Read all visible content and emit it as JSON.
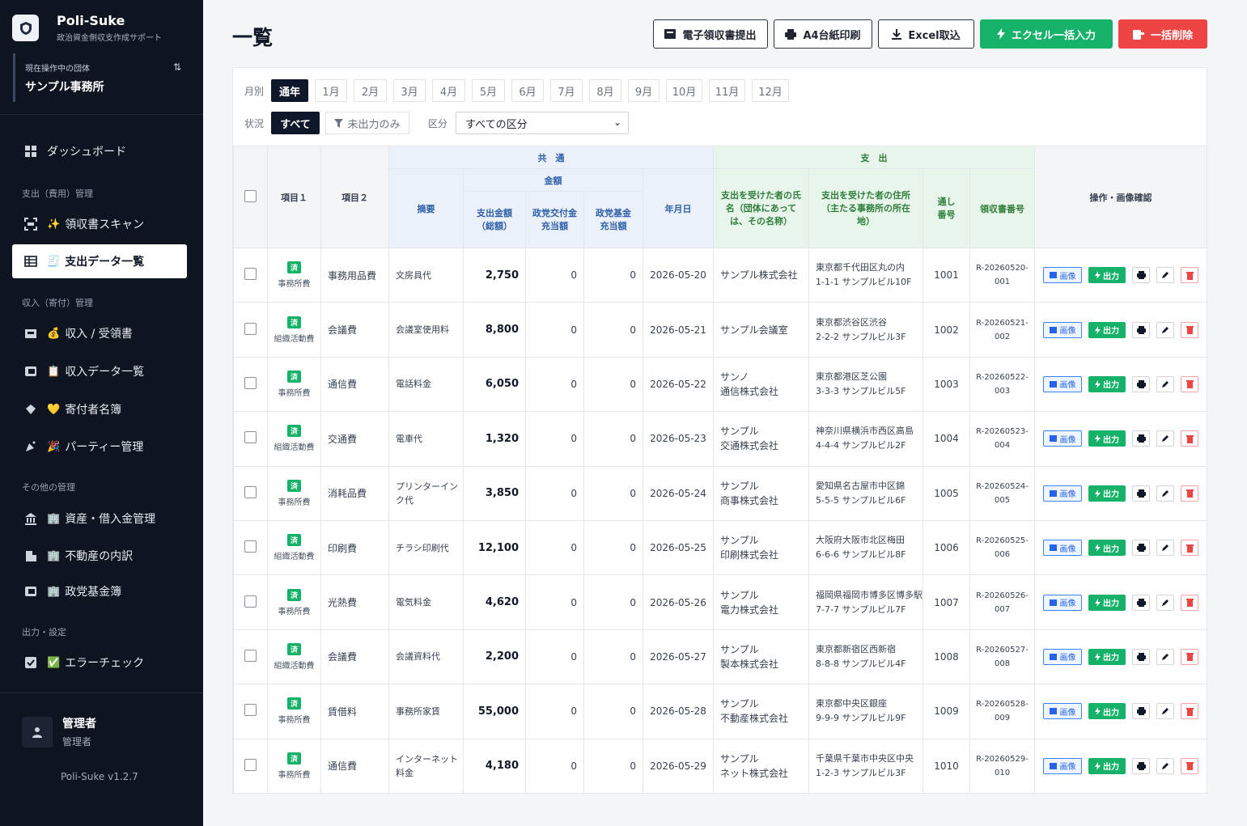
{
  "brand": {
    "name": "Poli-Suke",
    "subtitle": "政治資金側収支作成サポート"
  },
  "org": {
    "label": "現在操作中の団体",
    "name": "サンプル事務所"
  },
  "sidebar": {
    "dashboard": "ダッシュボード",
    "section_expense": "支出（費用）管理",
    "receipt_scan": "領収書スキャン",
    "expense_list": "支出データ一覧",
    "section_income": "収入（寄付）管理",
    "income_receipt": "収入 / 受領書",
    "income_list": "収入データ一覧",
    "donor_list": "寄付者名簿",
    "party_mgmt": "パーティー管理",
    "section_other": "その他の管理",
    "assets": "資産・借入金管理",
    "real_estate": "不動産の内訳",
    "fund_book": "政党基金簿",
    "section_output": "出力・設定",
    "error_check": "エラーチェック"
  },
  "user": {
    "name": "管理者",
    "role": "管理者"
  },
  "version": "Poli-Suke v1.2.7",
  "page": {
    "title": "一覧"
  },
  "toolbar": {
    "e_receipt": "電子領収書提出",
    "print_a4": "A4台紙印刷",
    "excel_import": "Excel取込",
    "excel_bulk": "エクセル一括入力",
    "bulk_delete": "一括削除"
  },
  "filters": {
    "month_label": "月別",
    "months": [
      "通年",
      "1月",
      "2月",
      "3月",
      "4月",
      "5月",
      "6月",
      "7月",
      "8月",
      "9月",
      "10月",
      "11月",
      "12月"
    ],
    "status_label": "状況",
    "status_all": "すべて",
    "status_unexported": "未出力のみ",
    "category_label": "区分",
    "category_value": "すべての区分"
  },
  "table": {
    "group_common": "共　通",
    "group_expense": "支　出",
    "group_amount": "金額",
    "col_item1": "項目１",
    "col_item2": "項目２",
    "col_summary": "摘要",
    "col_total": "支出金額（総額）",
    "col_party_grant": "政党交付金充当額",
    "col_party_fund": "政党基金充当額",
    "col_date": "年月日",
    "col_payee": "支出を受けた者の氏名（団体にあっては、その名称）",
    "col_address": "支出を受けた者の住所（主たる事務所の所在地）",
    "col_serial": "通し番号",
    "col_receipt_no": "領収書番号",
    "col_ops": "操作・画像確認",
    "op_image": "画像",
    "op_output": "出力",
    "rows": [
      {
        "status": "済",
        "item1": "事務所費",
        "item2": "事務用品費",
        "summary": "文房具代",
        "total": "2,750",
        "grant": "0",
        "fund": "0",
        "date": "2026-05-20",
        "payee": "サンプル株式会社",
        "address": "東京都千代田区丸の内\n1-1-1 サンプルビル10F",
        "serial": "1001",
        "receipt": "R-20260520-\n001"
      },
      {
        "status": "済",
        "item1": "組織活動費",
        "item2": "会議費",
        "summary": "会議室使用料",
        "total": "8,800",
        "grant": "0",
        "fund": "0",
        "date": "2026-05-21",
        "payee": "サンプル会議室",
        "address": "東京都渋谷区渋谷\n2-2-2 サンプルビル3F",
        "serial": "1002",
        "receipt": "R-20260521-\n002"
      },
      {
        "status": "済",
        "item1": "事務所費",
        "item2": "通信費",
        "summary": "電話料金",
        "total": "6,050",
        "grant": "0",
        "fund": "0",
        "date": "2026-05-22",
        "payee": "サンノ\n通信株式会社",
        "address": "東京都港区芝公園\n3-3-3 サンプルビル5F",
        "serial": "1003",
        "receipt": "R-20260522-\n003"
      },
      {
        "status": "済",
        "item1": "組織活動費",
        "item2": "交通費",
        "summary": "電車代",
        "total": "1,320",
        "grant": "0",
        "fund": "0",
        "date": "2026-05-23",
        "payee": "サンプル\n交通株式会社",
        "address": "神奈川県横浜市西区高島\n4-4-4 サンプルビル2F",
        "serial": "1004",
        "receipt": "R-20260523-\n004"
      },
      {
        "status": "済",
        "item1": "事務所費",
        "item2": "消耗品費",
        "summary": "プリンターイン\nク代",
        "total": "3,850",
        "grant": "0",
        "fund": "0",
        "date": "2026-05-24",
        "payee": "サンプル\n商事株式会社",
        "address": "愛知県名古屋市中区錦\n5-5-5 サンプルビル6F",
        "serial": "1005",
        "receipt": "R-20260524-\n005"
      },
      {
        "status": "済",
        "item1": "組織活動費",
        "item2": "印刷費",
        "summary": "チラシ印刷代",
        "total": "12,100",
        "grant": "0",
        "fund": "0",
        "date": "2026-05-25",
        "payee": "サンプル\n印刷株式会社",
        "address": "大阪府大阪市北区梅田\n6-6-6 サンプルビル8F",
        "serial": "1006",
        "receipt": "R-20260525-\n006"
      },
      {
        "status": "済",
        "item1": "事務所費",
        "item2": "光熱費",
        "summary": "電気料金",
        "total": "4,620",
        "grant": "0",
        "fund": "0",
        "date": "2026-05-26",
        "payee": "サンプル\n電力株式会社",
        "address": "福岡県福岡市博多区博多駅\n7-7-7 サンプルビル7F",
        "serial": "1007",
        "receipt": "R-20260526-\n007"
      },
      {
        "status": "済",
        "item1": "組織活動費",
        "item2": "会議費",
        "summary": "会議資料代",
        "total": "2,200",
        "grant": "0",
        "fund": "0",
        "date": "2026-05-27",
        "payee": "サンプル\n製本株式会社",
        "address": "東京都新宿区西新宿\n8-8-8 サンプルビル4F",
        "serial": "1008",
        "receipt": "R-20260527-\n008"
      },
      {
        "status": "済",
        "item1": "事務所費",
        "item2": "賃借料",
        "summary": "事務所家賃",
        "total": "55,000",
        "grant": "0",
        "fund": "0",
        "date": "2026-05-28",
        "payee": "サンプル\n不動産株式会社",
        "address": "東京都中央区銀座\n9-9-9 サンプルビル9F",
        "serial": "1009",
        "receipt": "R-20260528-\n009"
      },
      {
        "status": "済",
        "item1": "事務所費",
        "item2": "通信費",
        "summary": "インターネット\n料金",
        "total": "4,180",
        "grant": "0",
        "fund": "0",
        "date": "2026-05-29",
        "payee": "サンプル\nネット株式会社",
        "address": "千葉県千葉市中央区中央\n1-2-3 サンプルビル3F",
        "serial": "1010",
        "receipt": "R-20260529-\n010"
      }
    ]
  },
  "colors": {
    "sidebar_bg": "#0e1420",
    "green": "#17b26a",
    "red": "#ef4444",
    "blue": "#2563eb"
  }
}
